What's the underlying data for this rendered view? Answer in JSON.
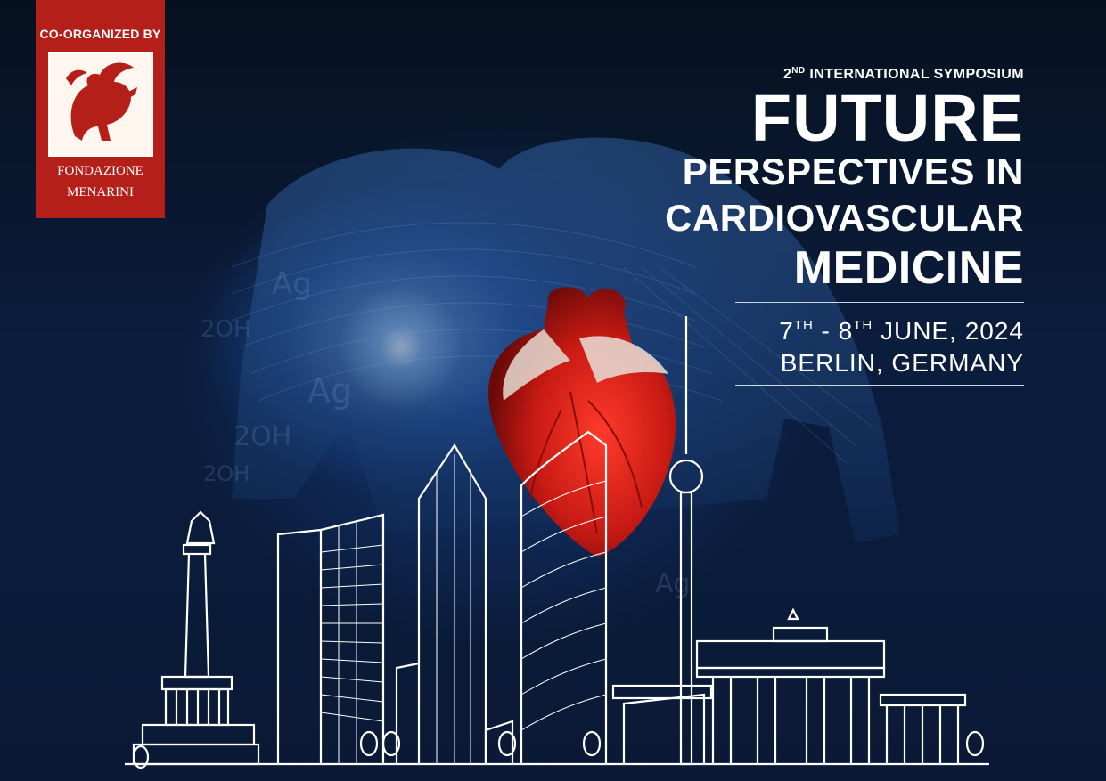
{
  "logo": {
    "co_label": "CO-ORGANIZED BY",
    "name_line1": "FONDAZIONE",
    "name_line2": "MENARINI",
    "emblem_icon": "pegasus-emblem-icon",
    "background_color": "#b51f1a"
  },
  "event": {
    "ordinal_number": "2",
    "ordinal_suffix": "ND",
    "kicker": "INTERNATIONAL SYMPOSIUM",
    "title_line1": "FUTURE",
    "title_line2": "PERSPECTIVES IN",
    "title_line3": "CARDIOVASCULAR",
    "title_line4": "MEDICINE",
    "date_day1": "7",
    "date_day1_suffix": "TH",
    "date_separator": " - ",
    "date_day2": "8",
    "date_day2_suffix": "TH",
    "date_rest": " JUNE, 2024",
    "location": "BERLIN, GERMANY"
  },
  "artwork": {
    "background_glyphs": [
      "2OH",
      "Ag",
      "2OH",
      "Ag",
      "2OH",
      "Ag"
    ],
    "heart_icon": "anatomical-heart-icon",
    "skyline_icon": "berlin-skyline-icon",
    "accent_color": "#d8241e"
  }
}
